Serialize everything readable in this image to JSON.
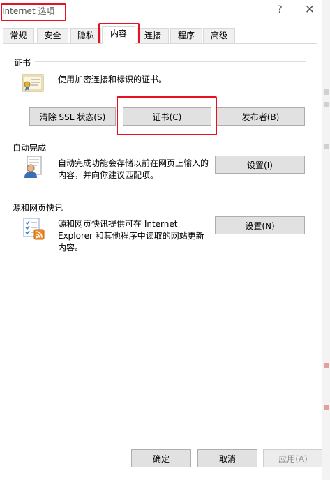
{
  "window": {
    "title": "Internet 选项",
    "help_label": "?",
    "close_label": "✕"
  },
  "tabs": [
    {
      "label": "常规"
    },
    {
      "label": "安全"
    },
    {
      "label": "隐私"
    },
    {
      "label": "内容"
    },
    {
      "label": "连接"
    },
    {
      "label": "程序"
    },
    {
      "label": "高级"
    }
  ],
  "active_tab": "内容",
  "certificates": {
    "section_label": "证书",
    "description": "使用加密连接和标识的证书。",
    "icon": "certificate-icon",
    "buttons": {
      "clear_ssl": "清除 SSL 状态(S)",
      "certificates": "证书(C)",
      "publishers": "发布者(B)"
    }
  },
  "autocomplete": {
    "section_label": "自动完成",
    "description_line1": "自动完成功能会存储以前在网页上输入的",
    "description_line2": "内容，并向你建议匹配项。",
    "icon": "autocomplete-user-icon",
    "settings_label": "设置(I)"
  },
  "feeds": {
    "section_label": "源和网页快讯",
    "description_line1": "源和网页快讯提供可在 Internet",
    "description_line2": "Explorer 和其他程序中读取的网站更新",
    "description_line3": "内容。",
    "icon": "feeds-rss-icon",
    "settings_label": "设置(N)"
  },
  "footer": {
    "ok": "确定",
    "cancel": "取消",
    "apply": "应用(A)"
  },
  "colors": {
    "highlight": "#e81123",
    "button_face": "#e1e1e1",
    "border": "#adadad"
  }
}
